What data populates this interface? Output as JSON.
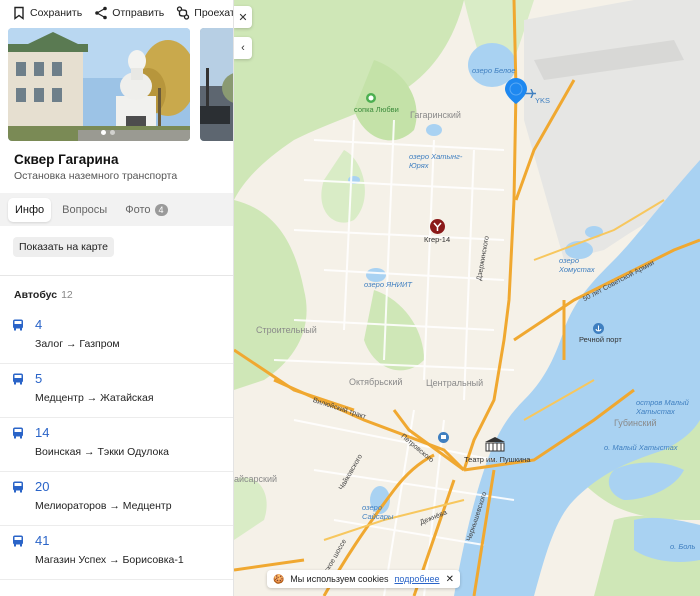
{
  "actions": {
    "save": "Сохранить",
    "share": "Отправить",
    "route": "Проехать"
  },
  "place": {
    "title": "Сквер Гагарина",
    "subtitle": "Остановка наземного транспорта"
  },
  "tabs": [
    {
      "label": "Инфо",
      "active": true
    },
    {
      "label": "Вопросы"
    },
    {
      "label": "Фото",
      "badge": "4"
    }
  ],
  "show_on_map": "Показать на карте",
  "bus": {
    "heading": "Автобус",
    "count": "12",
    "routes": [
      {
        "number": "4",
        "direction": "Залог → Газпром"
      },
      {
        "number": "5",
        "direction": "Медцентр → Жатайская"
      },
      {
        "number": "14",
        "direction": "Воинская → Тэкки Одулока"
      },
      {
        "number": "20",
        "direction": "Мелиораторов → Медцентр"
      },
      {
        "number": "41",
        "direction": "Магазин Успех → Борисовка-1"
      }
    ]
  },
  "map": {
    "labels": {
      "lake_beloe": "озеро Белое",
      "yks": "YKS",
      "sopka": "сопка Любви",
      "gagarinsky": "Гагаринский",
      "lake_khatyng": "озеро Хатынг-Юрях",
      "kger": "Кгер-14",
      "lake_yniit": "озеро ЯНИИТ",
      "lake_khomustakh": "озеро Хомустах",
      "dzerzhinskogo": "Дзержинского",
      "sov_armii": "50 лет Советской Армии",
      "stroitelny": "Строительный",
      "rechnoy_port": "Речной порт",
      "oktyabrsky": "Октябрьский",
      "centralny": "Центральный",
      "vilyuysky": "Вилюйский тракт",
      "petrovskogo": "Петровского",
      "teatr": "Театр им. Пушкина",
      "ostrov_maly": "остров Малый Хатыстах",
      "gubinsky": "Губинский",
      "chaikovskogo": "Чайковского",
      "chernyshevskogo": "Чернышевского",
      "ost_maly": "о. Малый Хатыстах",
      "yaisarsky": "айсарский",
      "lake_saisary": "озеро Сайсары",
      "dezhneva": "Дежнёва",
      "shosse": "иевское шоссе",
      "bol": "о. Боль"
    }
  },
  "cookie": {
    "text": "Мы используем cookies",
    "more": "подробнее"
  },
  "colors": {
    "link": "#2a64c8",
    "pin": "#1e88f0",
    "water": "#a9d2f2",
    "green": "#c4e2a8",
    "road": "#f0a830"
  }
}
